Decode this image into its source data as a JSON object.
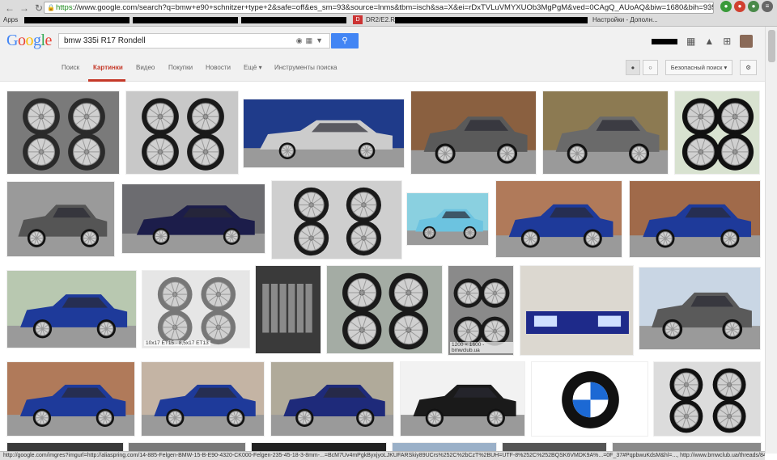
{
  "browser": {
    "url_scheme": "https",
    "url_rest": "://www.google.com/search?q=bmw+e90+schnitzer+type+2&safe=off&es_sm=93&source=lnms&tbm=isch&sa=X&ei=rDxTVLuVMYXUOb3MgPgM&ved=0CAgQ_AUoAQ&biw=1680&bih=935#q",
    "bookmarks": {
      "apps": "Apps",
      "dr_label": "DR2/E2.RU",
      "settings": "Настройки - Дополн..."
    },
    "status_text": "http://google.com/imgres?imgurl=http://aliaspring.com/14-885-Felgen-BMW-15-B-E90-4320-CK000-Felgen-235-45-18-3-8mm-...=BcM7Uv4mPgkByxjyoLJKUFARSkiy89UCrs%252C%2bCzT%2BUH=UTF-8%252C%252BQSK6VMDK9A%...=0F_37#PqpbwuKdsM&hl=..., http://www.bmwclub.ua/threads/8405-%25D0%25A5%25D1%2583..."
  },
  "header": {
    "logo_letters": [
      {
        "ch": "G",
        "color": "#4285f4"
      },
      {
        "ch": "o",
        "color": "#ea4335"
      },
      {
        "ch": "o",
        "color": "#fbbc05"
      },
      {
        "ch": "g",
        "color": "#4285f4"
      },
      {
        "ch": "l",
        "color": "#34a853"
      },
      {
        "ch": "e",
        "color": "#ea4335"
      }
    ],
    "query": "bmw 335i R17 Rondell",
    "search_icon": "search-icon"
  },
  "tabs": [
    "Поиск",
    "Картинки",
    "Видео",
    "Покупки",
    "Новости",
    "Ещё ▾",
    "Инструменты поиска"
  ],
  "active_tab": 1,
  "toolbar": {
    "safe_search": "Безопасный поиск ▾"
  },
  "colors": {
    "accent": "#c53929",
    "search_blue": "#4285f4"
  },
  "grid": [
    {
      "bg": "#7a7a7a",
      "fg": "#2a2a2a",
      "kind": "wheels4",
      "label": ""
    },
    {
      "bg": "#c8c8c8",
      "fg": "#1a1a1a",
      "kind": "wheels4",
      "label": ""
    },
    {
      "bg": "#1f3b8a",
      "fg": "#cccccc",
      "kind": "wheelcar",
      "label": ""
    },
    {
      "bg": "#8a6040",
      "fg": "#5a5a5a",
      "kind": "car",
      "label": ""
    },
    {
      "bg": "#8c7a52",
      "fg": "#6a6a6a",
      "kind": "car",
      "label": ""
    },
    {
      "bg": "#d8e2d0",
      "fg": "#111111",
      "kind": "wheels4",
      "label": ""
    },
    {
      "bg": "#9a9a9a",
      "fg": "#555555",
      "kind": "car",
      "label": ""
    },
    {
      "bg": "#6c6c70",
      "fg": "#1c1d4a",
      "kind": "car",
      "label": ""
    },
    {
      "bg": "#cfcfcf",
      "fg": "#1a1a1a",
      "kind": "wheels4",
      "label": ""
    },
    {
      "bg": "#8ad0e0",
      "fg": "#6cc3e0",
      "kind": "car",
      "label": ""
    },
    {
      "bg": "#b07a5a",
      "fg": "#1e3a9a",
      "kind": "car",
      "label": ""
    },
    {
      "bg": "#a06a4a",
      "fg": "#1e3a9a",
      "kind": "car",
      "label": ""
    },
    {
      "bg": "#b8c8b0",
      "fg": "#1e3a9a",
      "kind": "car",
      "label": ""
    },
    {
      "bg": "#e6e6e6",
      "fg": "#777777",
      "kind": "wheels4",
      "label": "10x17 ET15 · 8,5x17 ET13"
    },
    {
      "bg": "#3a3a3a",
      "fg": "#8a8a8a",
      "kind": "engine",
      "label": ""
    },
    {
      "bg": "#a4aca4",
      "fg": "#1a1a1a",
      "kind": "wheels4",
      "label": ""
    },
    {
      "bg": "#8a8a8a",
      "fg": "#1a1a1a",
      "kind": "wheels4",
      "label": "1200 × 1600 - bmwclub.ua"
    },
    {
      "bg": "#dcd8d0",
      "fg": "#1e2a8a",
      "kind": "light",
      "label": ""
    },
    {
      "bg": "#c9d6e4",
      "fg": "#5a5a5a",
      "kind": "car",
      "label": ""
    },
    {
      "bg": "#b07a5a",
      "fg": "#1e3a9a",
      "kind": "car",
      "label": ""
    },
    {
      "bg": "#c4b4a4",
      "fg": "#1e3a9a",
      "kind": "car",
      "label": ""
    },
    {
      "bg": "#b0aa9a",
      "fg": "#1e2a7a",
      "kind": "car",
      "label": ""
    },
    {
      "bg": "#f2f2f2",
      "fg": "#1a1a1a",
      "kind": "car",
      "label": ""
    },
    {
      "bg": "#ffffff",
      "fg": "#000000",
      "kind": "logo",
      "label": ""
    },
    {
      "bg": "#dcdcdc",
      "fg": "#111111",
      "kind": "wheels4",
      "label": ""
    },
    {
      "bg": "#3a3a3a",
      "fg": "#1a1a1a",
      "kind": "strip",
      "label": ""
    },
    {
      "bg": "#7a7a7a",
      "fg": "#1a1a1a",
      "kind": "strip",
      "label": ""
    },
    {
      "bg": "#222222",
      "fg": "#1a1a1a",
      "kind": "strip",
      "label": ""
    },
    {
      "bg": "#9ab0c8",
      "fg": "#1a1a1a",
      "kind": "strip",
      "label": ""
    },
    {
      "bg": "#555555",
      "fg": "#1a1a1a",
      "kind": "strip",
      "label": ""
    },
    {
      "bg": "#8a8a8a",
      "fg": "#1a1a1a",
      "kind": "strip",
      "label": ""
    }
  ]
}
